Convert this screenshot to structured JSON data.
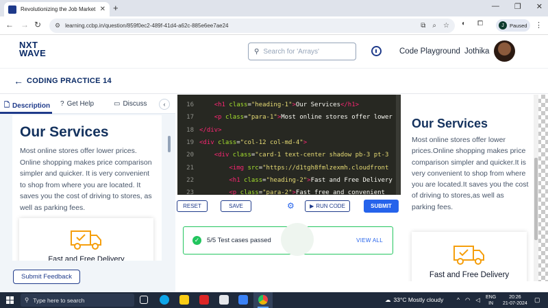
{
  "browser": {
    "tab_title": "Revolutionizing the Job Market",
    "url": "learning.ccbp.in/question/859f0ec2-489f-41d4-a62c-885e6ee7ae24",
    "profile_initial": "J",
    "profile_status": "Paused"
  },
  "header": {
    "logo_line1": "NXT",
    "logo_line2": "WAVE",
    "search_placeholder": "Search for 'Arrays'",
    "code_playground": "Code Playground",
    "user_name": "Jothika"
  },
  "practice": {
    "title": "CODING PRACTICE 14"
  },
  "left_tabs": {
    "description": "Description",
    "get_help": "Get Help",
    "discuss": "Discuss"
  },
  "description": {
    "heading": "Our Services",
    "body": "Most online stores offer lower prices. Online shopping makes price comparison simpler and quicker. It is very convenient to shop from where you are located. It saves you the cost of driving to stores, as well as parking fees.",
    "card_title": "Fast and Free Delivery"
  },
  "feedback_button": "Submit Feedback",
  "editor": {
    "lines": [
      {
        "num": "16",
        "indent": "    ",
        "parts": [
          [
            "tag",
            "<h1 "
          ],
          [
            "attr",
            "class"
          ],
          [
            "txt",
            "="
          ],
          [
            "str",
            "\"heading-1\""
          ],
          [
            "tag",
            ">"
          ],
          [
            "txt",
            "Our Services"
          ],
          [
            "tag",
            "</h1>"
          ]
        ]
      },
      {
        "num": "17",
        "indent": "    ",
        "parts": [
          [
            "tag",
            "<p "
          ],
          [
            "attr",
            "class"
          ],
          [
            "txt",
            "="
          ],
          [
            "str",
            "\"para-1\""
          ],
          [
            "tag",
            ">"
          ],
          [
            "txt",
            "Most online stores offer lower"
          ]
        ]
      },
      {
        "num": "18",
        "indent": "",
        "parts": [
          [
            "tag",
            "</div>"
          ]
        ]
      },
      {
        "num": "19",
        "indent": "",
        "parts": [
          [
            "tag",
            "<div "
          ],
          [
            "attr",
            "class"
          ],
          [
            "txt",
            "="
          ],
          [
            "str",
            "\"col-12 col-md-4\""
          ],
          [
            "tag",
            ">"
          ]
        ]
      },
      {
        "num": "20",
        "indent": "    ",
        "parts": [
          [
            "tag",
            "<div "
          ],
          [
            "attr",
            "class"
          ],
          [
            "txt",
            "="
          ],
          [
            "str",
            "\"card-1 text-center shadow pb-3 pt-3"
          ]
        ]
      },
      {
        "num": "21",
        "indent": "        ",
        "parts": [
          [
            "tag",
            "<img "
          ],
          [
            "attr",
            "src"
          ],
          [
            "txt",
            "="
          ],
          [
            "str",
            "\"https://d1tgh8fmlzexmh.cloudfront"
          ]
        ]
      },
      {
        "num": "22",
        "indent": "        ",
        "parts": [
          [
            "tag",
            "<h1 "
          ],
          [
            "attr",
            "class"
          ],
          [
            "txt",
            "="
          ],
          [
            "str",
            "\"heading-2\""
          ],
          [
            "tag",
            ">"
          ],
          [
            "txt",
            "Fast and Free Delivery"
          ]
        ]
      },
      {
        "num": "23",
        "indent": "        ",
        "parts": [
          [
            "tag",
            "<p "
          ],
          [
            "attr",
            "class"
          ],
          [
            "txt",
            "="
          ],
          [
            "str",
            "\"para-2\""
          ],
          [
            "tag",
            ">"
          ],
          [
            "txt",
            "Fast free and convenient"
          ]
        ]
      }
    ]
  },
  "actions": {
    "reset": "RESET",
    "save": "SAVE",
    "run_code": "RUN CODE",
    "submit": "SUBMIT"
  },
  "result": {
    "text": "5/5 Test cases passed",
    "view_all": "VIEW ALL"
  },
  "preview": {
    "heading": "Our Services",
    "body": "Most online stores offer lower prices.Online shopping makes price comparison simpler and quicker.It is very convenient to shop from where you are located.It saves you the cost of driving to stores,as well as parking fees.",
    "card_title": "Fast and Free Delivery"
  },
  "taskbar": {
    "search_placeholder": "Type here to search",
    "weather": "33°C  Mostly cloudy",
    "lang_line1": "ENG",
    "lang_line2": "IN",
    "time": "20:26",
    "date": "21-07-2024"
  },
  "colors": {
    "brand_navy": "#1e3a8a",
    "submit_blue": "#2563eb",
    "success_green": "#22c55e",
    "editor_bg": "#272822"
  }
}
